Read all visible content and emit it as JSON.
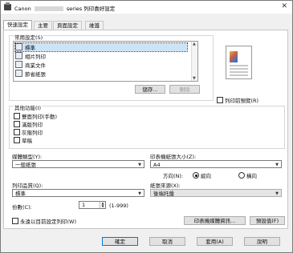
{
  "window": {
    "app_name": "Canon",
    "title_suffix": "series 列印喜好設定",
    "close_symbol": "✕"
  },
  "tabs": [
    {
      "label": "快速設定",
      "active": true
    },
    {
      "label": "主要"
    },
    {
      "label": "頁面設定"
    },
    {
      "label": "維護"
    }
  ],
  "common_settings": {
    "label": "常用設定(S)",
    "items": [
      "標準",
      "相片列印",
      "商業文件",
      "節省紙張"
    ],
    "save_button": "儲存...",
    "delete_button": "刪除"
  },
  "preview_checkbox": "列印前預覽(R)",
  "extra_features": {
    "label": "其他功能(I)",
    "items": [
      "雙面列印(手動)",
      "滿版列印",
      "灰階列印",
      "草稿"
    ]
  },
  "media_type": {
    "label": "媒體類型(Y):",
    "value": "一般紙張"
  },
  "paper_size": {
    "label": "印表機紙張大小(Z):",
    "value": "A4"
  },
  "orientation": {
    "label": "方向(N):",
    "portrait": "縱向",
    "landscape": "橫向",
    "selected": "portrait"
  },
  "print_quality": {
    "label": "列印品質(Q):",
    "value": "標準"
  },
  "paper_source": {
    "label": "紙張來源(X):",
    "value": "後端托盤"
  },
  "copies": {
    "label": "份數(C):",
    "value": "1",
    "range": "(1-999)"
  },
  "always_print_current": "永遠以目前設定列印(W)",
  "printer_media_info_button": "印表機媒體資訊...",
  "defaults_button": "預設值(F)",
  "footer_buttons": {
    "ok": "確定",
    "cancel": "取消",
    "apply": "套用(A)",
    "help": "說明"
  }
}
